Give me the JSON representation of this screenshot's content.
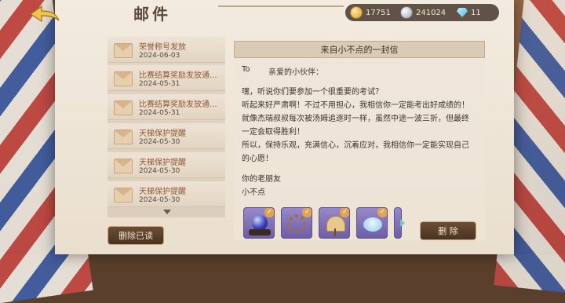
{
  "header": {
    "title": "邮件"
  },
  "currencies": [
    {
      "icon": "gold-coin-icon",
      "value": "17751"
    },
    {
      "icon": "silver-coin-icon",
      "value": "241024"
    },
    {
      "icon": "diamond-icon",
      "value": "11"
    }
  ],
  "mail_list": [
    {
      "subject": "荣誉称号发放",
      "date": "2024-06-03"
    },
    {
      "subject": "比赛结算奖励发放通...",
      "date": "2024-05-31"
    },
    {
      "subject": "比赛结算奖励发放通...",
      "date": "2024-05-31"
    },
    {
      "subject": "天梯保护提醒",
      "date": "2024-05-30"
    },
    {
      "subject": "天梯保护提醒",
      "date": "2024-05-30"
    },
    {
      "subject": "天梯保护提醒",
      "date": "2024-05-30"
    }
  ],
  "buttons": {
    "delete_read": "删除已读",
    "delete": "删 除"
  },
  "letter": {
    "title": "来自小不点的一封信",
    "to_label": "To",
    "recipient": "亲爱的小伙伴：",
    "lines": [
      "嘿，听说你们要参加一个很重要的考试？",
      "听起来好严肃啊！不过不用担心，我相信你一定能考出好成绩的！",
      "就像杰瑞叔叔每次被汤姆追逐时一样，虽然中途一波三折，但最终",
      "一定会取得胜利！",
      "所以，保持乐观，充满信心，沉着应对，我相信你一定能实现自己",
      "的心愿！"
    ],
    "sign_line1": "你的老朋友",
    "sign_line2": "小不点",
    "attachments": [
      "crystal-orb-icon",
      "prayer-beads-icon",
      "fan-icon",
      "cloud-jelly-icon"
    ]
  }
}
